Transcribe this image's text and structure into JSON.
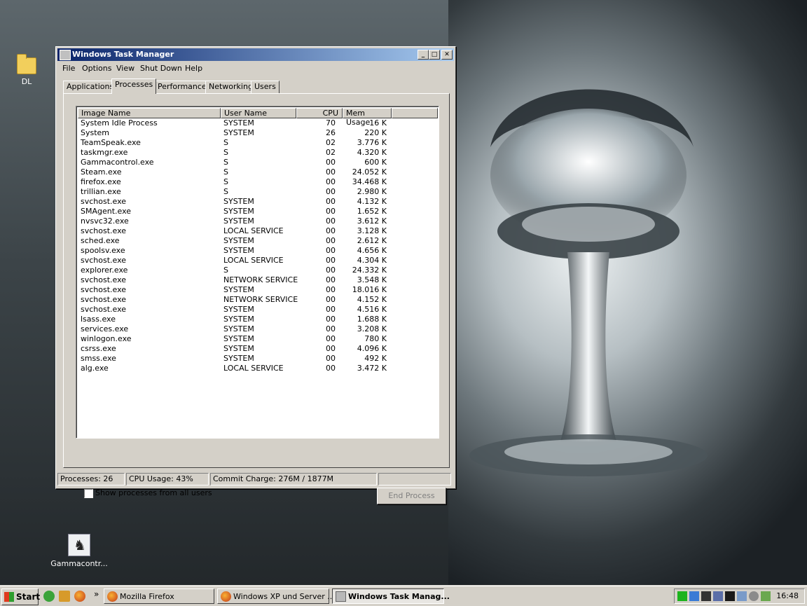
{
  "desktop": {
    "icons": [
      {
        "label": "DL"
      },
      {
        "label": "Gammacontr..."
      }
    ]
  },
  "window": {
    "title": "Windows Task Manager",
    "buttons": {
      "minimize": "_",
      "maximize": "□",
      "close": "✕"
    },
    "menu": [
      "File",
      "Options",
      "View",
      "Shut Down",
      "Help"
    ],
    "tabs": [
      "Applications",
      "Processes",
      "Performance",
      "Networking",
      "Users"
    ],
    "active_tab": "Processes",
    "columns": [
      "Image Name",
      "User Name",
      "CPU",
      "Mem Usage"
    ],
    "processes": [
      {
        "name": "System Idle Process",
        "user": "SYSTEM",
        "cpu": "70",
        "mem": "16 K"
      },
      {
        "name": "System",
        "user": "SYSTEM",
        "cpu": "26",
        "mem": "220 K"
      },
      {
        "name": "TeamSpeak.exe",
        "user": "S",
        "cpu": "02",
        "mem": "3.776 K"
      },
      {
        "name": "taskmgr.exe",
        "user": "S",
        "cpu": "02",
        "mem": "4.320 K"
      },
      {
        "name": "Gammacontrol.exe",
        "user": "S",
        "cpu": "00",
        "mem": "600 K"
      },
      {
        "name": "Steam.exe",
        "user": "S",
        "cpu": "00",
        "mem": "24.052 K"
      },
      {
        "name": "firefox.exe",
        "user": "S",
        "cpu": "00",
        "mem": "34.468 K"
      },
      {
        "name": "trillian.exe",
        "user": "S",
        "cpu": "00",
        "mem": "2.980 K"
      },
      {
        "name": "svchost.exe",
        "user": "SYSTEM",
        "cpu": "00",
        "mem": "4.132 K"
      },
      {
        "name": "SMAgent.exe",
        "user": "SYSTEM",
        "cpu": "00",
        "mem": "1.652 K"
      },
      {
        "name": "nvsvc32.exe",
        "user": "SYSTEM",
        "cpu": "00",
        "mem": "3.612 K"
      },
      {
        "name": "svchost.exe",
        "user": "LOCAL SERVICE",
        "cpu": "00",
        "mem": "3.128 K"
      },
      {
        "name": "sched.exe",
        "user": "SYSTEM",
        "cpu": "00",
        "mem": "2.612 K"
      },
      {
        "name": "spoolsv.exe",
        "user": "SYSTEM",
        "cpu": "00",
        "mem": "4.656 K"
      },
      {
        "name": "svchost.exe",
        "user": "LOCAL SERVICE",
        "cpu": "00",
        "mem": "4.304 K"
      },
      {
        "name": "explorer.exe",
        "user": "S",
        "cpu": "00",
        "mem": "24.332 K"
      },
      {
        "name": "svchost.exe",
        "user": "NETWORK SERVICE",
        "cpu": "00",
        "mem": "3.548 K"
      },
      {
        "name": "svchost.exe",
        "user": "SYSTEM",
        "cpu": "00",
        "mem": "18.016 K"
      },
      {
        "name": "svchost.exe",
        "user": "NETWORK SERVICE",
        "cpu": "00",
        "mem": "4.152 K"
      },
      {
        "name": "svchost.exe",
        "user": "SYSTEM",
        "cpu": "00",
        "mem": "4.516 K"
      },
      {
        "name": "lsass.exe",
        "user": "SYSTEM",
        "cpu": "00",
        "mem": "1.688 K"
      },
      {
        "name": "services.exe",
        "user": "SYSTEM",
        "cpu": "00",
        "mem": "3.208 K"
      },
      {
        "name": "winlogon.exe",
        "user": "SYSTEM",
        "cpu": "00",
        "mem": "780 K"
      },
      {
        "name": "csrss.exe",
        "user": "SYSTEM",
        "cpu": "00",
        "mem": "4.096 K"
      },
      {
        "name": "smss.exe",
        "user": "SYSTEM",
        "cpu": "00",
        "mem": "492 K"
      },
      {
        "name": "alg.exe",
        "user": "LOCAL SERVICE",
        "cpu": "00",
        "mem": "3.472 K"
      }
    ],
    "show_all_label": "Show processes from all users",
    "show_all_checked": false,
    "end_process_label": "End Process",
    "status": {
      "processes": "Processes: 26",
      "cpu": "CPU Usage: 43%",
      "commit": "Commit Charge: 276M / 1877M"
    }
  },
  "taskbar": {
    "start_label": "Start",
    "overflow": "»",
    "buttons": [
      {
        "label": "Mozilla Firefox",
        "icon": "firefox-icon"
      },
      {
        "label": "Windows XP und Server ...",
        "icon": "firefox-icon"
      },
      {
        "label": "Windows Task Manag...",
        "icon": "taskmgr-icon"
      }
    ],
    "clock": "16:48"
  },
  "colors": {
    "title_start": "#0a246a",
    "title_end": "#a6caf0",
    "face": "#d4d0c8"
  }
}
